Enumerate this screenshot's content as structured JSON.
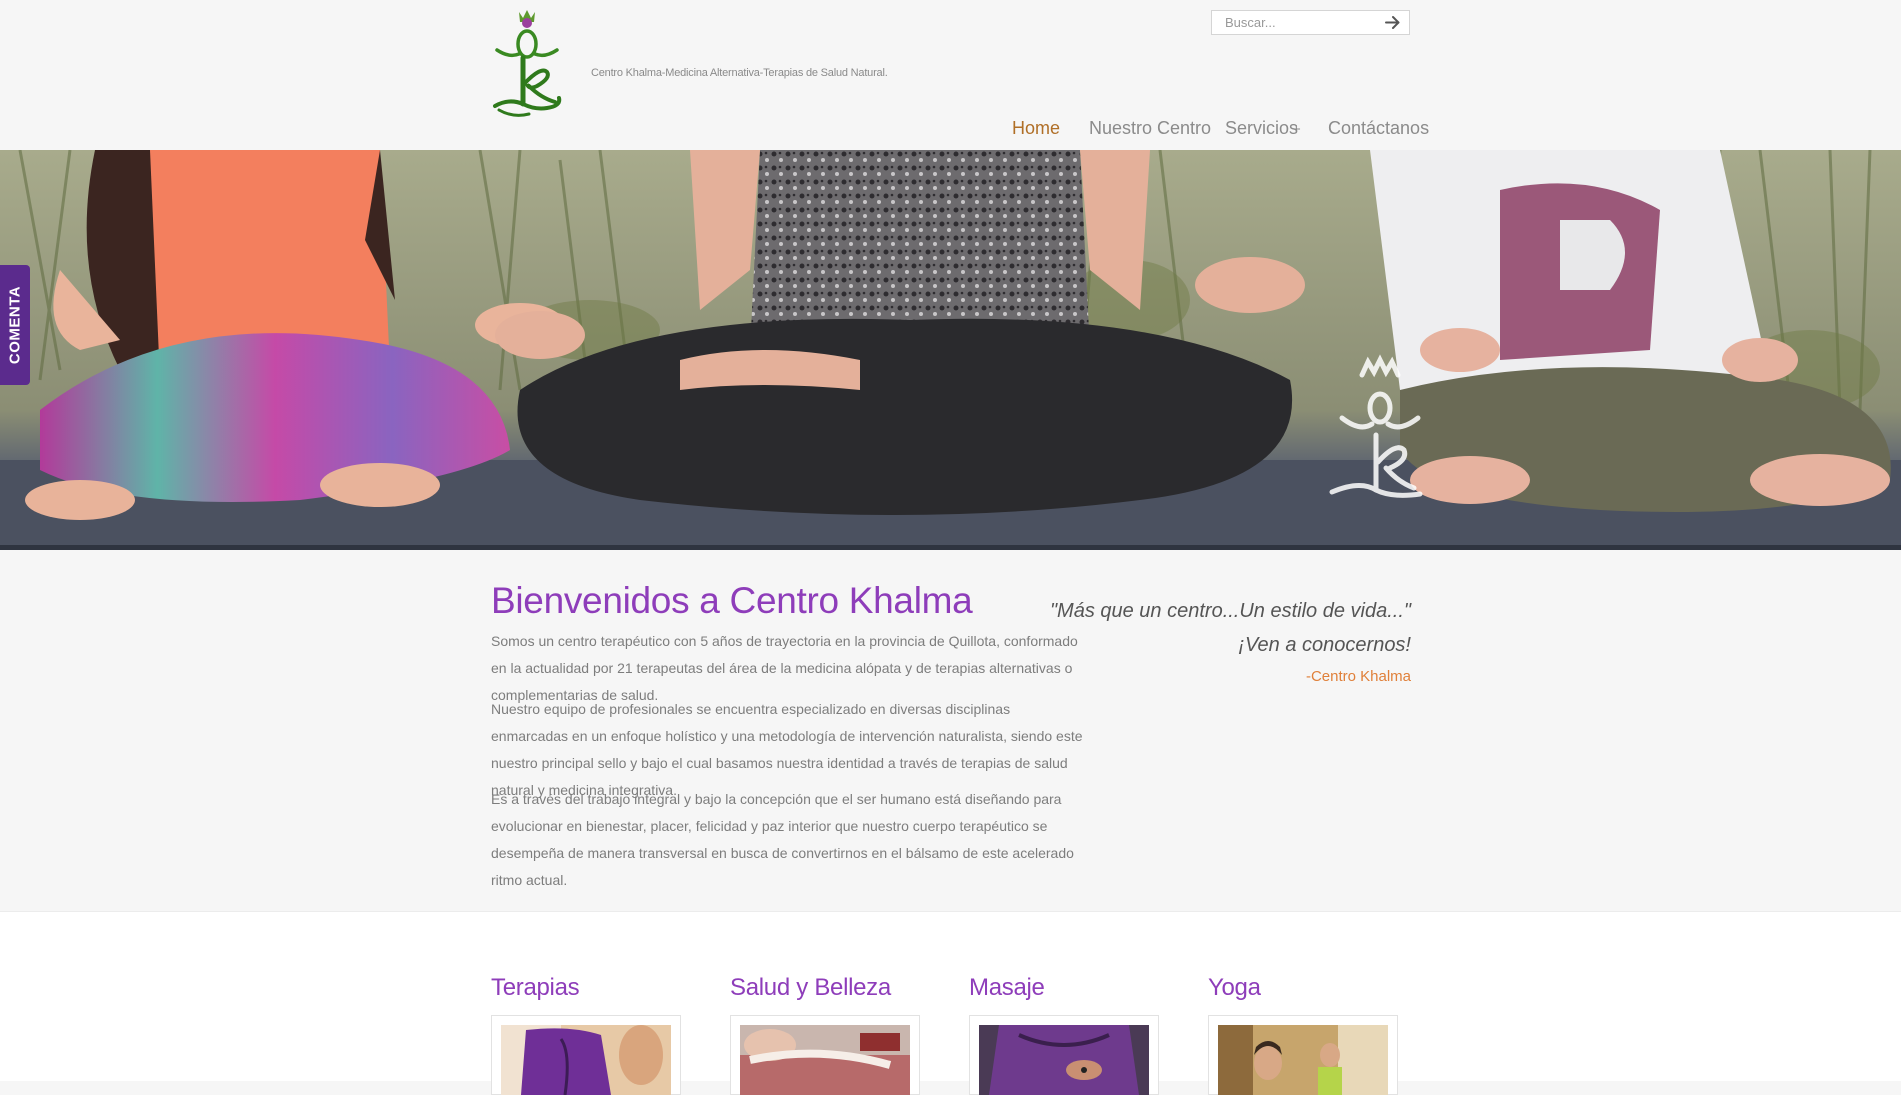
{
  "header": {
    "tagline": "Centro Khalma-Medicina Alternativa-Terapias de Salud Natural.",
    "search_placeholder": "Buscar...",
    "search_button_icon": "arrow-right-icon"
  },
  "nav": {
    "items": [
      {
        "label": "Home",
        "active": true
      },
      {
        "label": "Nuestro Centro",
        "active": false
      },
      {
        "label": "Servicios",
        "active": false,
        "has_submenu": true,
        "submenu_icon": "+"
      },
      {
        "label": "Contáctanos",
        "active": false
      }
    ]
  },
  "comenta_tab": {
    "label": "COMENTA"
  },
  "welcome": {
    "title": "Bienvenidos a Centro Khalma",
    "paragraphs": [
      "Somos un centro terapéutico con 5 años de trayectoria en la provincia de Quillota, conformado en la actualidad por 21 terapeutas del área de la medicina alópata y de terapias alternativas o complementarias de salud.",
      "Nuestro equipo de profesionales se encuentra especializado en diversas disciplinas enmarcadas en un enfoque holístico y una metodología de intervención naturalista, siendo este nuestro principal sello y bajo el cual basamos nuestra identidad a través de terapias de salud natural y medicina integrativa.",
      "Es a través del trabajo integral y bajo la concepción que el ser humano está diseñando para evolucionar en bienestar, placer, felicidad y paz interior que nuestro cuerpo terapéutico se desempeña de manera transversal en busca de convertirnos en el bálsamo de este acelerado ritmo actual."
    ],
    "quote_line1": "\"Más que un centro...Un estilo de vida...\"",
    "quote_line2": "¡Ven a conocernos!",
    "quote_author": "-Centro Khalma"
  },
  "services": [
    {
      "title": "Terapias"
    },
    {
      "title": "Salud y Belleza"
    },
    {
      "title": "Masaje"
    },
    {
      "title": "Yoga"
    }
  ],
  "colors": {
    "accent_purple": "#8e3dba",
    "nav_active": "#b06f27",
    "quote_author": "#e0803a",
    "comenta_tab": "#5b2b8d",
    "logo_green": "#3a8a22"
  }
}
